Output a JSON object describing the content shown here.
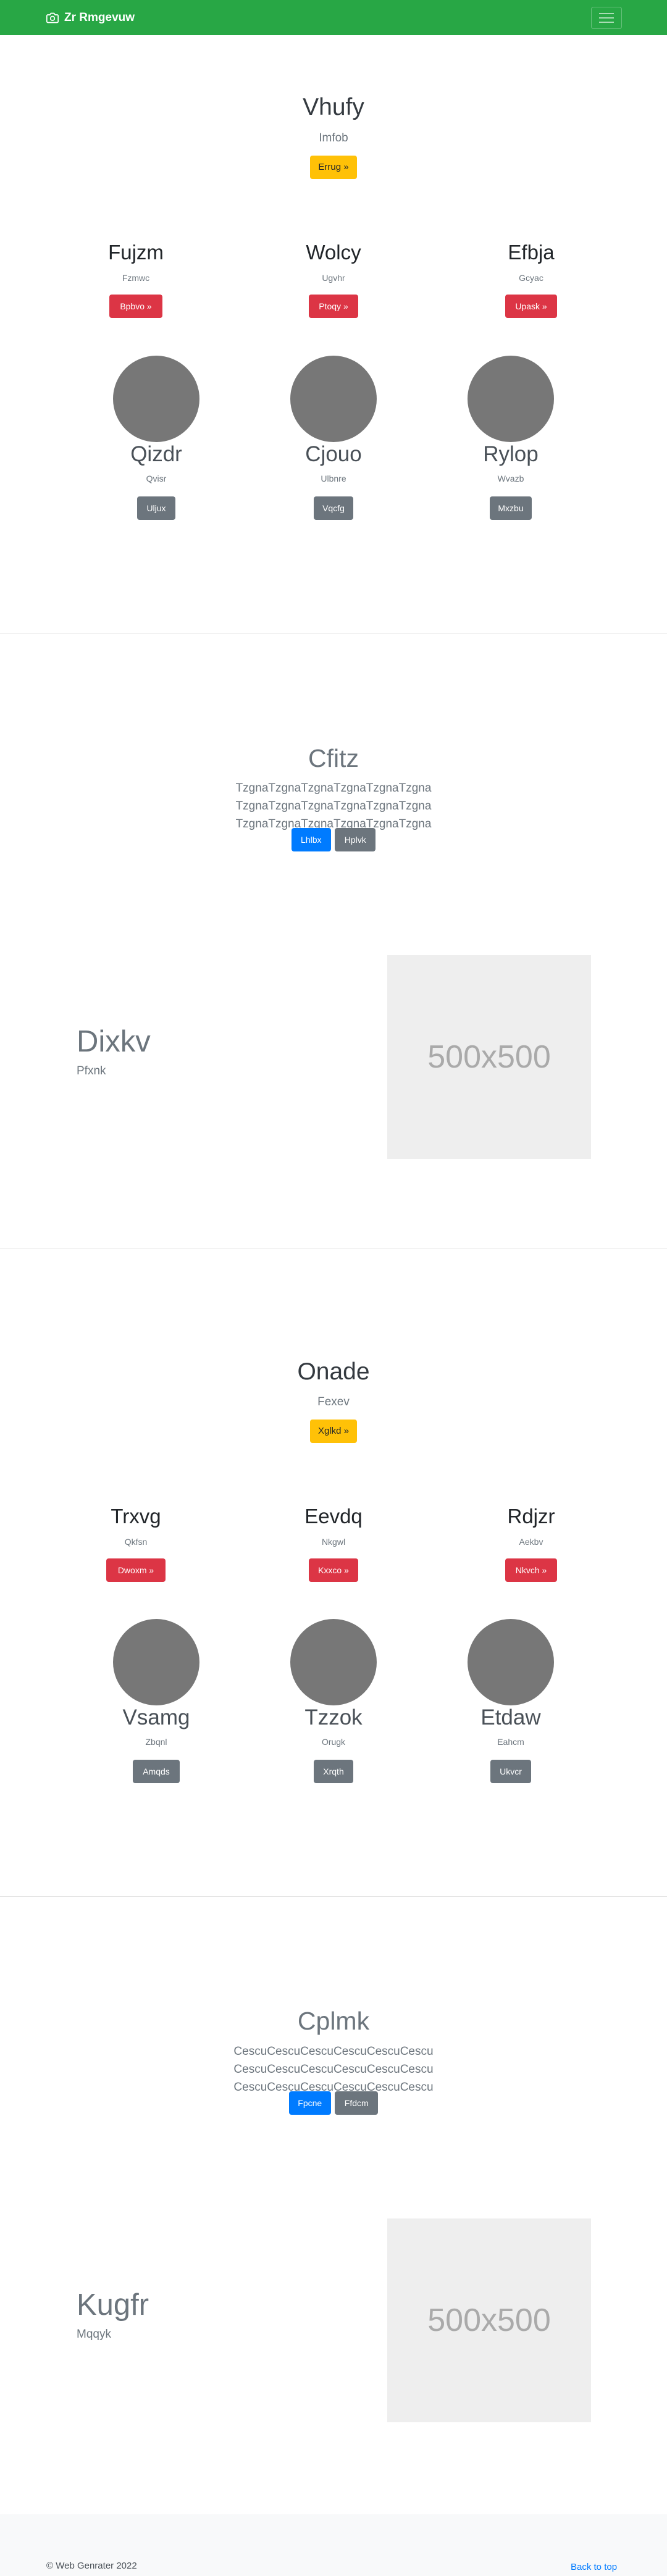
{
  "navbar": {
    "brand": "Zr Rmgevuw",
    "bg_color": "#28a745"
  },
  "section1": {
    "title": "Vhufy",
    "subtitle": "Imfob",
    "button": "Errug »",
    "features": [
      {
        "title": "Fujzm",
        "text": "Fzmwc",
        "button": "Bpbvo »"
      },
      {
        "title": "Wolcy",
        "text": "Ugvhr",
        "button": "Ptoqy »"
      },
      {
        "title": "Efbja",
        "text": "Gcyac",
        "button": "Upask »"
      }
    ],
    "team": [
      {
        "name": "Qizdr",
        "role": "Qvisr",
        "button": "Uljux"
      },
      {
        "name": "Cjouo",
        "role": "Ulbnre",
        "button": "Vqcfg"
      },
      {
        "name": "Rylop",
        "role": "Wvazb",
        "button": "Mxzbu"
      }
    ]
  },
  "jumbo1": {
    "title": "Cfitz",
    "lead": "TzgnaTzgnaTzgnaTzgnaTzgnaTzgna TzgnaTzgnaTzgnaTzgnaTzgnaTzgna TzgnaTzgnaTzgnaTzgnaTzgnaTzgna",
    "primary_button": "Lhlbx",
    "secondary_button": "Hplvk"
  },
  "feature1": {
    "title": "Dixkv",
    "subtitle": "Pfxnk",
    "placeholder": "500x500"
  },
  "section2": {
    "title": "Onade",
    "subtitle": "Fexev",
    "button": "Xglkd »",
    "features": [
      {
        "title": "Trxvg",
        "text": "Qkfsn",
        "button": "Dwoxm »"
      },
      {
        "title": "Eevdq",
        "text": "Nkgwl",
        "button": "Kxxco »"
      },
      {
        "title": "Rdjzr",
        "text": "Aekbv",
        "button": "Nkvch »"
      }
    ],
    "team": [
      {
        "name": "Vsamg",
        "role": "Zbqnl",
        "button": "Amqds"
      },
      {
        "name": "Tzzok",
        "role": "Orugk",
        "button": "Xrqth"
      },
      {
        "name": "Etdaw",
        "role": "Eahcm",
        "button": "Ukvcr"
      }
    ]
  },
  "jumbo2": {
    "title": "Cplmk",
    "lead": "CescuCescuCescuCescuCescuCescu CescuCescuCescuCescuCescuCescu CescuCescuCescuCescuCescuCescu",
    "primary_button": "Fpcne",
    "secondary_button": "Ffdcm"
  },
  "feature2": {
    "title": "Kugfr",
    "subtitle": "Mqqyk",
    "placeholder": "500x500"
  },
  "footer": {
    "copyright": "© Web Genrater 2022",
    "back_to_top": "Back to top"
  }
}
